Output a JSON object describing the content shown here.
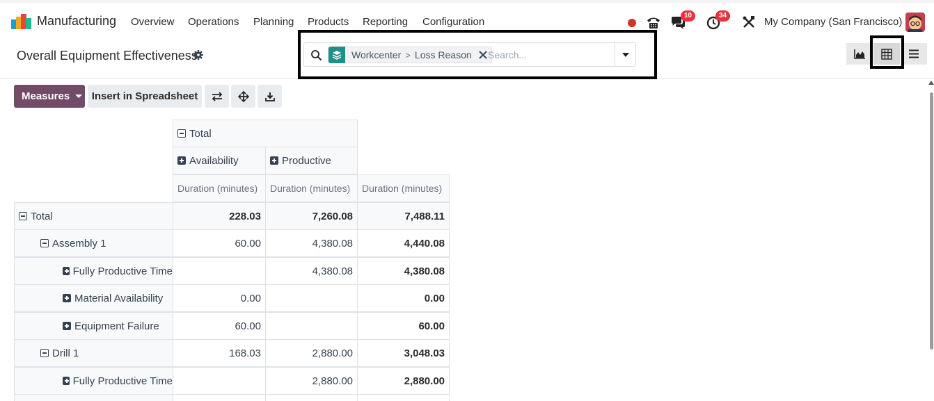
{
  "app": {
    "name": "Manufacturing",
    "menu": [
      "Overview",
      "Operations",
      "Planning",
      "Products",
      "Reporting",
      "Configuration"
    ],
    "chat_count": "10",
    "activity_count": "34",
    "company": "My Company (San Francisco)"
  },
  "control_panel": {
    "title": "Overall Equipment Effectiveness",
    "facet": {
      "values": [
        "Workcenter",
        "Loss Reason"
      ],
      "separator": ">"
    },
    "search_placeholder": "Search..."
  },
  "toolbar": {
    "measures_label": "Measures",
    "spreadsheet_label": "Insert in Spreadsheet"
  },
  "pivot": {
    "col_group_total": "Total",
    "col_groups": [
      "Availability",
      "Productive"
    ],
    "measure": "Duration (minutes)",
    "rows": [
      {
        "label": "Total",
        "level": 0,
        "toggle": "minus",
        "values": [
          "228.03",
          "7,260.08",
          "7,488.11"
        ],
        "bold_all": true
      },
      {
        "label": "Assembly 1",
        "level": 1,
        "toggle": "minus",
        "values": [
          "60.00",
          "4,380.08",
          "4,440.08"
        ]
      },
      {
        "label": "Fully Productive Time",
        "level": 2,
        "toggle": "plus",
        "values": [
          "",
          "4,380.08",
          "4,380.08"
        ]
      },
      {
        "label": "Material Availability",
        "level": 2,
        "toggle": "plus",
        "values": [
          "0.00",
          "",
          "0.00"
        ]
      },
      {
        "label": "Equipment Failure",
        "level": 2,
        "toggle": "plus",
        "values": [
          "60.00",
          "",
          "60.00"
        ]
      },
      {
        "label": "Drill 1",
        "level": 1,
        "toggle": "minus",
        "values": [
          "168.03",
          "2,880.00",
          "3,048.03"
        ]
      },
      {
        "label": "Fully Productive Time",
        "level": 2,
        "toggle": "plus",
        "values": [
          "",
          "2,880.00",
          "2,880.00"
        ]
      }
    ]
  },
  "colors": {
    "brand": "#714b67",
    "facet": "#1f8f8a",
    "badge": "#e8323f"
  }
}
